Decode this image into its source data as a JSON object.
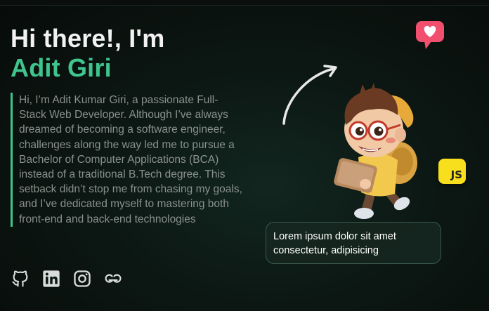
{
  "hero": {
    "greeting": "Hi there!, I'm",
    "name": "Adit Giri",
    "bio": "Hi, I’m Adit Kumar Giri, a passionate Full-Stack Web Developer. Although I’ve always dreamed of becoming a software engineer, challenges along the way led me to pursue a Bachelor of Computer Applications (BCA) instead of a traditional B.Tech degree. This setback didn’t stop me from chasing my goals, and I’ve dedicated myself to mastering both front-end and back-end technologies"
  },
  "socials": [
    {
      "icon": "github-icon"
    },
    {
      "icon": "linkedin-icon"
    },
    {
      "icon": "instagram-icon"
    },
    {
      "icon": "geeksforgeeks-icon"
    }
  ],
  "badges": {
    "js_label": "JS"
  },
  "tooltip": {
    "text": "Lorem ipsum dolor sit amet consectetur, adipisicing"
  },
  "colors": {
    "accent": "#3fc58d",
    "heart": "#f0506e",
    "js_badge": "#f7df1e"
  }
}
